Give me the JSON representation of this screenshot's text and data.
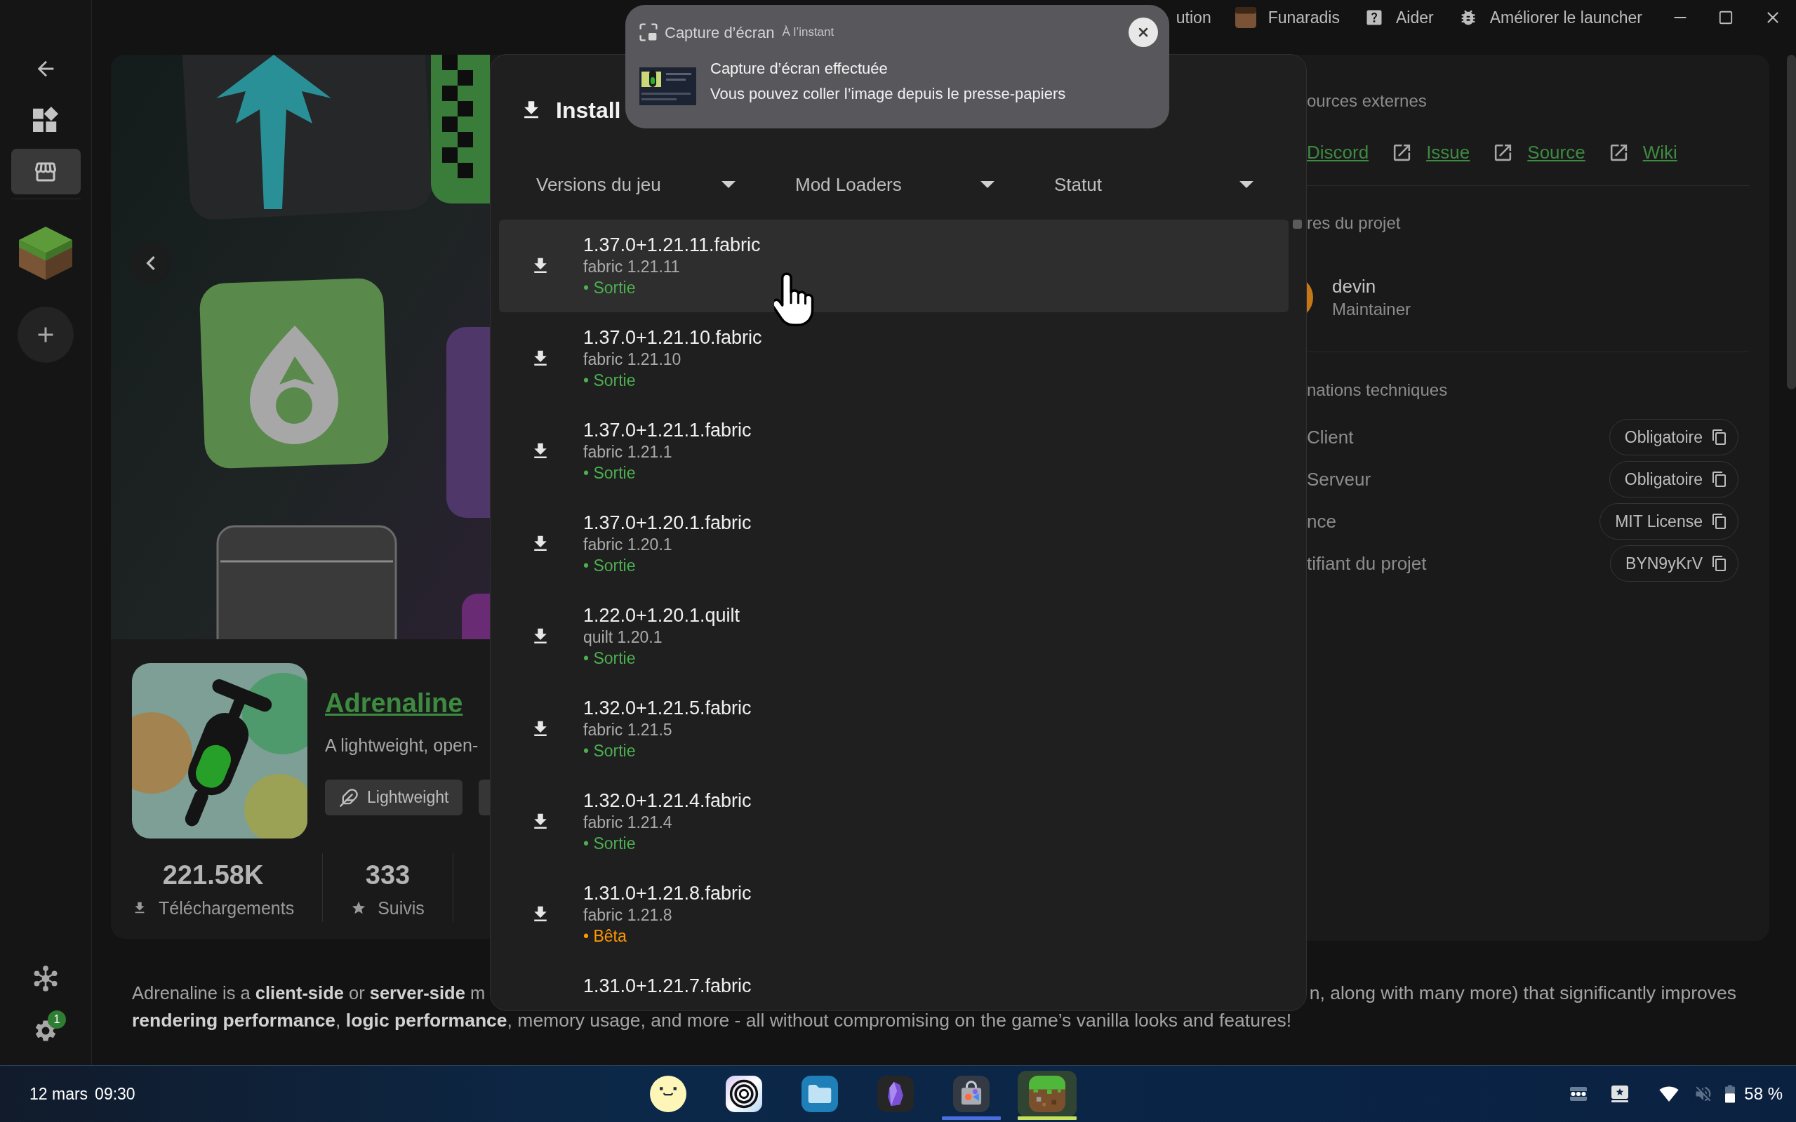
{
  "top_bar": {
    "cut_item": "ution",
    "account": {
      "name": "Funaradis"
    },
    "help": {
      "label": "Aider"
    },
    "feedback": {
      "label": "Améliorer le launcher"
    }
  },
  "notification": {
    "app": "Capture d’écran",
    "time": "À l’instant",
    "title": "Capture d’écran effectuée",
    "message": "Vous pouvez coller l’image depuis le presse-papiers"
  },
  "sidebar": {
    "nav": [
      {
        "kind": "library",
        "selected": false
      },
      {
        "kind": "store",
        "selected": true
      }
    ],
    "settings_badge": "1"
  },
  "project": {
    "title": "Adrenaline",
    "summary": "A lightweight, open-",
    "tags": [
      {
        "label": "Lightweight"
      }
    ],
    "stats": [
      {
        "kind": "downloads",
        "value": "221.58K",
        "label": "Téléchargements"
      },
      {
        "kind": "followers",
        "value": "333",
        "label": "Suivis"
      }
    ]
  },
  "description": {
    "line_1_start": "Adrenaline is a **client-side** or **server-side** m",
    "line_1_end": "n, along with many more) that significantly improves",
    "line_2": "**rendering performance**, **logic performance**, memory usage, and more - all without compromising on the game’s vanilla looks and features!"
  },
  "details": {
    "links_heading": "ources externes",
    "links": [
      {
        "label": "Discord",
        "icon": false
      },
      {
        "label": "Issue",
        "icon": true
      },
      {
        "label": "Source",
        "icon": true
      },
      {
        "label": "Wiki",
        "icon": true
      }
    ],
    "members_heading": "res du projet",
    "members": [
      {
        "name": "devin",
        "role": "Maintainer"
      }
    ],
    "tech_heading": "nations techniques",
    "tech": [
      {
        "label": "Client",
        "value": "Obligatoire"
      },
      {
        "label": "Serveur",
        "value": "Obligatoire"
      },
      {
        "label": "nce",
        "value": "MIT License"
      },
      {
        "label": "tifiant du projet",
        "value": "BYN9yKrV"
      }
    ]
  },
  "dialog": {
    "title": "Install",
    "filters": [
      {
        "label": "Versions du jeu"
      },
      {
        "label": "Mod Loaders"
      },
      {
        "label": "Statut"
      }
    ],
    "versions": [
      {
        "name": "1.37.0+1.21.11.fabric",
        "loader": "fabric 1.21.11",
        "status": "• Sortie",
        "color": "#4caf50",
        "highlighted": true
      },
      {
        "name": "1.37.0+1.21.10.fabric",
        "loader": "fabric 1.21.10",
        "status": "• Sortie",
        "color": "#4caf50",
        "highlighted": false
      },
      {
        "name": "1.37.0+1.21.1.fabric",
        "loader": "fabric 1.21.1",
        "status": "• Sortie",
        "color": "#4caf50",
        "highlighted": false
      },
      {
        "name": "1.37.0+1.20.1.fabric",
        "loader": "fabric 1.20.1",
        "status": "• Sortie",
        "color": "#4caf50",
        "highlighted": false
      },
      {
        "name": "1.22.0+1.20.1.quilt",
        "loader": "quilt 1.20.1",
        "status": "• Sortie",
        "color": "#4caf50",
        "highlighted": false
      },
      {
        "name": "1.32.0+1.21.5.fabric",
        "loader": "fabric 1.21.5",
        "status": "• Sortie",
        "color": "#4caf50",
        "highlighted": false
      },
      {
        "name": "1.32.0+1.21.4.fabric",
        "loader": "fabric 1.21.4",
        "status": "• Sortie",
        "color": "#4caf50",
        "highlighted": false
      },
      {
        "name": "1.31.0+1.21.8.fabric",
        "loader": "fabric 1.21.8",
        "status": "• Bêta",
        "color": "#ff9800",
        "highlighted": false
      },
      {
        "name": "1.31.0+1.21.7.fabric",
        "highlighted": false
      }
    ]
  },
  "taskbar": {
    "date": "12 mars",
    "time": "09:30",
    "apps": [
      {
        "kind": "emoji",
        "running": false,
        "active": false
      },
      {
        "kind": "rings",
        "running": false,
        "active": false
      },
      {
        "kind": "files",
        "running": false,
        "active": false
      },
      {
        "kind": "crystal",
        "running": false,
        "active": false
      },
      {
        "kind": "store",
        "running": true,
        "active": false
      },
      {
        "kind": "grass",
        "running": true,
        "active": true
      }
    ],
    "battery": "58 %"
  }
}
